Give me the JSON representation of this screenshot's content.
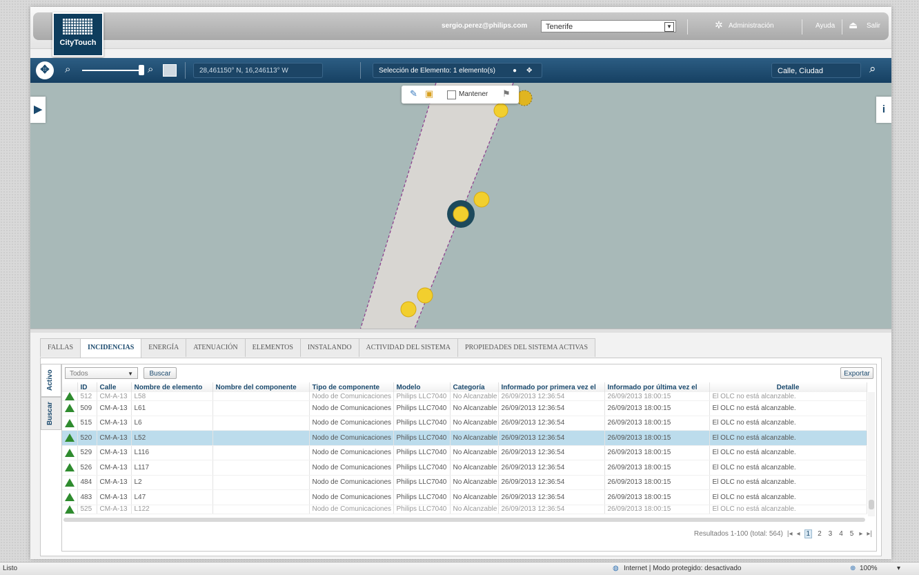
{
  "header": {
    "logo_text": "CityTouch",
    "user_email": "sergio.perez@philips.com",
    "region_selected": "Tenerife",
    "admin_label": "Administración",
    "help_label": "Ayuda",
    "logout_label": "Salir"
  },
  "toolbar": {
    "coordinates": "28,461150° N,  16,246113° W",
    "selection_text": "Selección de Elemento:  1 elemento(s)",
    "search_placeholder": "Calle, Ciudad"
  },
  "map": {
    "keep_label": "Mantener"
  },
  "tabs": [
    "FALLAS",
    "INCIDENCIAS",
    "ENERGÍA",
    "ATENUACIÓN",
    "ELEMENTOS",
    "INSTALANDO",
    "ACTIVIDAD DEL SISTEMA",
    "PROPIEDADES DEL SISTEMA ACTIVAS"
  ],
  "side_tabs": {
    "active": "Activo",
    "search": "Buscar"
  },
  "filter": {
    "selected": "Todos",
    "search_button": "Buscar",
    "export_button": "Exportar"
  },
  "table": {
    "columns": [
      "ID",
      "Calle",
      "Nombre de elemento",
      "Nombre del componente",
      "Tipo de componente",
      "Modelo",
      "Categoría",
      "Informado por primera vez el",
      "Informado por última vez el",
      "Detalle"
    ],
    "partial_top": [
      "512",
      "CM-A-13",
      "L58",
      "",
      "Nodo de Comunicaciones",
      "Philips LLC7040",
      "No Alcanzable",
      "26/09/2013 12:36:54",
      "26/09/2013 18:00:15",
      "El OLC no está alcanzable."
    ],
    "rows": [
      [
        "509",
        "CM-A-13",
        "L61",
        "",
        "Nodo de Comunicaciones",
        "Philips LLC7040",
        "No Alcanzable",
        "26/09/2013 12:36:54",
        "26/09/2013 18:00:15",
        "El OLC no está alcanzable."
      ],
      [
        "515",
        "CM-A-13",
        "L6",
        "",
        "Nodo de Comunicaciones",
        "Philips LLC7040",
        "No Alcanzable",
        "26/09/2013 12:36:54",
        "26/09/2013 18:00:15",
        "El OLC no está alcanzable."
      ],
      [
        "520",
        "CM-A-13",
        "L52",
        "",
        "Nodo de Comunicaciones",
        "Philips LLC7040",
        "No Alcanzable",
        "26/09/2013 12:36:54",
        "26/09/2013 18:00:15",
        "El OLC no está alcanzable."
      ],
      [
        "529",
        "CM-A-13",
        "L116",
        "",
        "Nodo de Comunicaciones",
        "Philips LLC7040",
        "No Alcanzable",
        "26/09/2013 12:36:54",
        "26/09/2013 18:00:15",
        "El OLC no está alcanzable."
      ],
      [
        "526",
        "CM-A-13",
        "L117",
        "",
        "Nodo de Comunicaciones",
        "Philips LLC7040",
        "No Alcanzable",
        "26/09/2013 12:36:54",
        "26/09/2013 18:00:15",
        "El OLC no está alcanzable."
      ],
      [
        "484",
        "CM-A-13",
        "L2",
        "",
        "Nodo de Comunicaciones",
        "Philips LLC7040",
        "No Alcanzable",
        "26/09/2013 12:36:54",
        "26/09/2013 18:00:15",
        "El OLC no está alcanzable."
      ],
      [
        "483",
        "CM-A-13",
        "L47",
        "",
        "Nodo de Comunicaciones",
        "Philips LLC7040",
        "No Alcanzable",
        "26/09/2013 12:36:54",
        "26/09/2013 18:00:15",
        "El OLC no está alcanzable."
      ]
    ],
    "partial_bottom": [
      "525",
      "CM-A-13",
      "L122",
      "",
      "Nodo de Comunicaciones",
      "Philips LLC7040",
      "No Alcanzable",
      "26/09/2013 12:36:54",
      "26/09/2013 18:00:15",
      "El OLC no está alcanzable."
    ],
    "selected_row_index": 2
  },
  "pager": {
    "results_text": "Resultados 1-100 (total: 564)",
    "pages": [
      "1",
      "2",
      "3",
      "4",
      "5"
    ],
    "current": "1"
  },
  "statusbar": {
    "left": "Listo",
    "zone": "Internet | Modo protegido: desactivado",
    "zoom": "100%"
  },
  "colors": {
    "toolbar_blue": "#164062",
    "selected_row": "#bcdcec",
    "map_water": "#a8b9b8",
    "road": "#d8d6d2",
    "luminaire": "#f2cf2e",
    "status_green": "#2e8b2e"
  }
}
